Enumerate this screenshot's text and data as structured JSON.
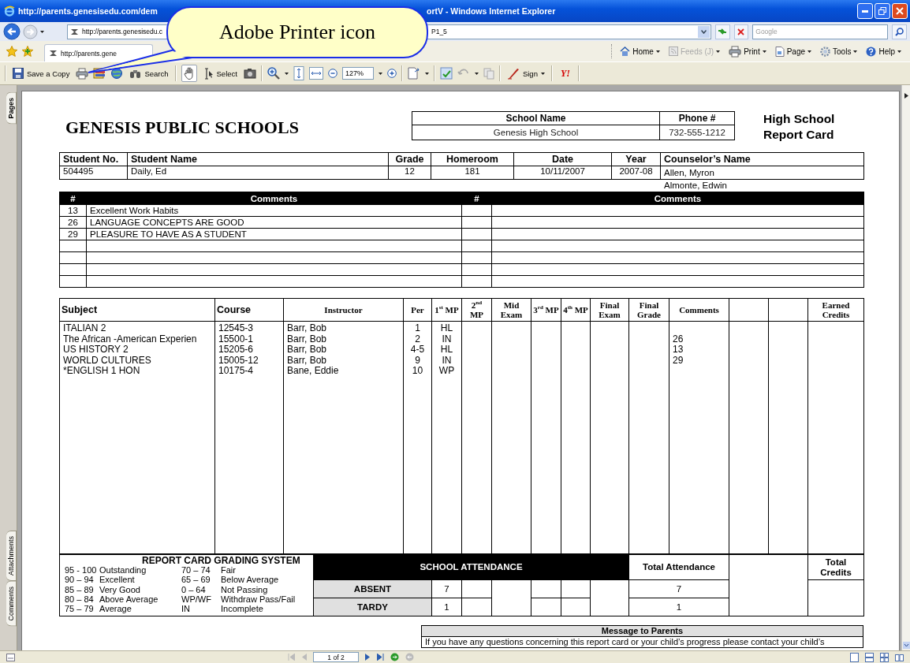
{
  "window": {
    "title_left": "http://parents.genesisedu.com/dem",
    "title_right": "ortV - Windows Internet Explorer"
  },
  "address_bar": {
    "url_left": "http://parents.genesisedu.c",
    "url_right": "P1_5",
    "search_placeholder": "Google"
  },
  "favorites_bar": {
    "tab_label": "http://parents.gene",
    "commands": [
      {
        "kind": "home",
        "label": "Home",
        "disabled": false
      },
      {
        "kind": "feeds",
        "label": "Feeds (J)",
        "disabled": true
      },
      {
        "kind": "print",
        "label": "Print",
        "disabled": false
      },
      {
        "kind": "page",
        "label": "Page",
        "disabled": false
      },
      {
        "kind": "tools",
        "label": "Tools",
        "disabled": false
      },
      {
        "kind": "help",
        "label": "Help",
        "disabled": false
      }
    ]
  },
  "pdf_toolbar": {
    "save_label": "Save a Copy",
    "search_label": "Search",
    "select_label": "Select",
    "zoom_value": "127%",
    "sign_label": "Sign",
    "yahoo_label": "Y!"
  },
  "callout": {
    "text": "Adobe Printer icon"
  },
  "side_panel": {
    "tabs": [
      "Pages",
      "Attachments",
      "Comments"
    ]
  },
  "report": {
    "school": {
      "district": "GENESIS PUBLIC SCHOOLS",
      "columns": [
        "School Name",
        "Phone #"
      ],
      "values": [
        "Genesis High School",
        "732-555-1212"
      ],
      "title_lines": [
        "High School",
        "Report Card"
      ]
    },
    "student": {
      "columns": [
        "Student No.",
        "Student Name",
        "Grade",
        "Homeroom",
        "Date",
        "Year",
        "Counselor’s Name"
      ],
      "values": [
        "504495",
        "Daily, Ed",
        "12",
        "181",
        "10/11/2007",
        "2007-08"
      ],
      "counselors": [
        "Allen, Myron",
        "Almonte, Edwin"
      ]
    },
    "comments": {
      "columns": [
        "#",
        "Comments",
        "#",
        "Comments"
      ],
      "rows": [
        {
          "number": "13",
          "text": "Excellent Work Habits"
        },
        {
          "number": "26",
          "text": "LANGUAGE CONCEPTS ARE GOOD"
        },
        {
          "number": "29",
          "text": "PLEASURE TO HAVE AS A STUDENT"
        }
      ]
    },
    "grades": {
      "columns": [
        "Subject",
        "Course",
        "Instructor",
        "Per",
        "1$^{st}$ MP",
        "2$^{nd}$ MP",
        "Mid Exam",
        "3$^{rd}$ MP",
        "4$^{th}$ MP",
        "Final Exam",
        "Final Grade",
        "Comments",
        "Earned Credits"
      ],
      "rows": [
        {
          "subject": "ITALIAN 2",
          "course": "12545-3",
          "instructor": "Barr, Bob",
          "per": "1",
          "mp1": "HL"
        },
        {
          "subject": "The African -American Experien",
          "course": "15500-1",
          "instructor": "Barr, Bob",
          "per": "2",
          "mp1": "IN",
          "comment": "26"
        },
        {
          "subject": "US HISTORY 2",
          "course": "15205-6",
          "instructor": "Barr, Bob",
          "per": "4-5",
          "mp1": "HL",
          "comment": "13"
        },
        {
          "subject": "WORLD CULTURES",
          "course": "15005-12",
          "instructor": "Barr, Bob",
          "per": "9",
          "mp1": "IN",
          "comment": "29"
        },
        {
          "subject": "*ENGLISH 1 HON",
          "course": "10175-4",
          "instructor": "Bane, Eddie",
          "per": "10",
          "mp1": "WP"
        }
      ]
    },
    "grading": {
      "title": "REPORT CARD GRADING SYSTEM",
      "scale": [
        [
          "95 - 100",
          "Outstanding",
          "70 – 74",
          "Fair"
        ],
        [
          "90 – 94",
          "Excellent",
          "65 – 69",
          "Below Average"
        ],
        [
          "85 – 89",
          "Very Good",
          "0 – 64",
          "Not Passing"
        ],
        [
          "80 – 84",
          "Above Average",
          "WP/WF",
          "Withdraw Pass/Fail"
        ],
        [
          "75 – 79",
          "Average",
          "IN",
          "Incomplete"
        ]
      ]
    },
    "attendance": {
      "title": "SCHOOL ATTENDANCE",
      "total_label": "Total Attendance",
      "credits_label": "Total Credits",
      "rows": [
        {
          "label": "ABSENT",
          "mp1": "7",
          "total": "7"
        },
        {
          "label": "TARDY",
          "mp1": "1",
          "total": "1"
        }
      ]
    },
    "message": {
      "title": "Message to Parents",
      "text": "If you have any questions concerning this report card or your child’s progress please contact your child’s"
    }
  },
  "status_bar": {
    "page_field": "1 of 2"
  }
}
